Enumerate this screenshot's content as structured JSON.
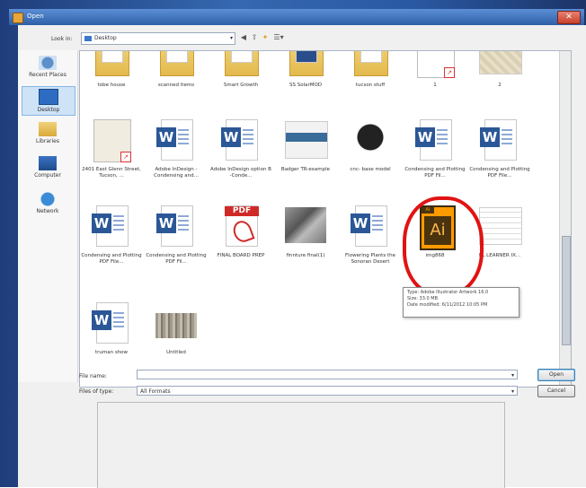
{
  "window": {
    "title": "Open",
    "close_glyph": "✕"
  },
  "lookin": {
    "label": "Look in:",
    "value": "Desktop",
    "caret": "▾"
  },
  "nav": {
    "back": "◀",
    "up": "⇧",
    "newfolder": "✦",
    "views": "☰▾"
  },
  "places": [
    {
      "label": "Recent Places",
      "icon": "recent-places-icon"
    },
    {
      "label": "Desktop",
      "icon": "desktop-icon"
    },
    {
      "label": "Libraries",
      "icon": "libraries-icon"
    },
    {
      "label": "Computer",
      "icon": "computer-icon"
    },
    {
      "label": "Network",
      "icon": "network-icon"
    }
  ],
  "files": {
    "row1": [
      {
        "label": "tobe house",
        "kind": "folder"
      },
      {
        "label": "scanned items",
        "kind": "folder"
      },
      {
        "label": "Smart Growth",
        "kind": "folder"
      },
      {
        "label": "SS SolarMOD",
        "kind": "folder"
      },
      {
        "label": "tucson stuff",
        "kind": "folder"
      },
      {
        "label": "1",
        "kind": "doc-pdf"
      },
      {
        "label": "2",
        "kind": "map"
      }
    ],
    "row2": [
      {
        "label": "2401 East Glenn Street, Tucson, ...",
        "kind": "doc-pdf"
      },
      {
        "label": "Adobe InDesign -Condensing and...",
        "kind": "word"
      },
      {
        "label": "Adobe InDesign option B -Conde...",
        "kind": "word"
      },
      {
        "label": "Badger TR-example",
        "kind": "slide"
      },
      {
        "label": "cnc- base model",
        "kind": "bw"
      },
      {
        "label": "Condensing and Plotting PDF Fil...",
        "kind": "word"
      },
      {
        "label": "Condensing and Plotting PDF File...",
        "kind": "word"
      }
    ],
    "row3": [
      {
        "label": "Condensing and Plotting PDF File...",
        "kind": "word"
      },
      {
        "label": "Condensing and Plotting PDF Fil...",
        "kind": "word"
      },
      {
        "label": "FINAL BOARD PREP",
        "kind": "pdf"
      },
      {
        "label": "finnture final(1)",
        "kind": "photo"
      },
      {
        "label": "Flowering Plants the Sonoran Desert",
        "kind": "word"
      },
      {
        "label": "img868",
        "kind": "ai"
      },
      {
        "label": "EL LEARNER IX...",
        "kind": "plan"
      }
    ],
    "row4": [
      {
        "label": "truman show",
        "kind": "word"
      },
      {
        "label": "Untitled",
        "kind": "aerial"
      }
    ]
  },
  "icons": {
    "word_letter": "W",
    "pdf_band": "PDF",
    "pdf_badge": "↗",
    "ai_tab": "AI",
    "ai_letters": "Ai"
  },
  "tooltip": {
    "line1": "Type: Adobe Illustrator Artwork 16.0",
    "line2": "Size: 33.0 MB",
    "line3": "Date modified: 6/11/2012 10:05 PM"
  },
  "filename": {
    "label": "File name:",
    "value": "",
    "caret": "▾"
  },
  "filetype": {
    "label": "Files of type:",
    "value": "All Formats",
    "caret": "▾"
  },
  "buttons": {
    "open": "Open",
    "cancel": "Cancel"
  },
  "colors": {
    "highlight_circle": "#e11313",
    "titlebar": "#2e5fa8"
  }
}
